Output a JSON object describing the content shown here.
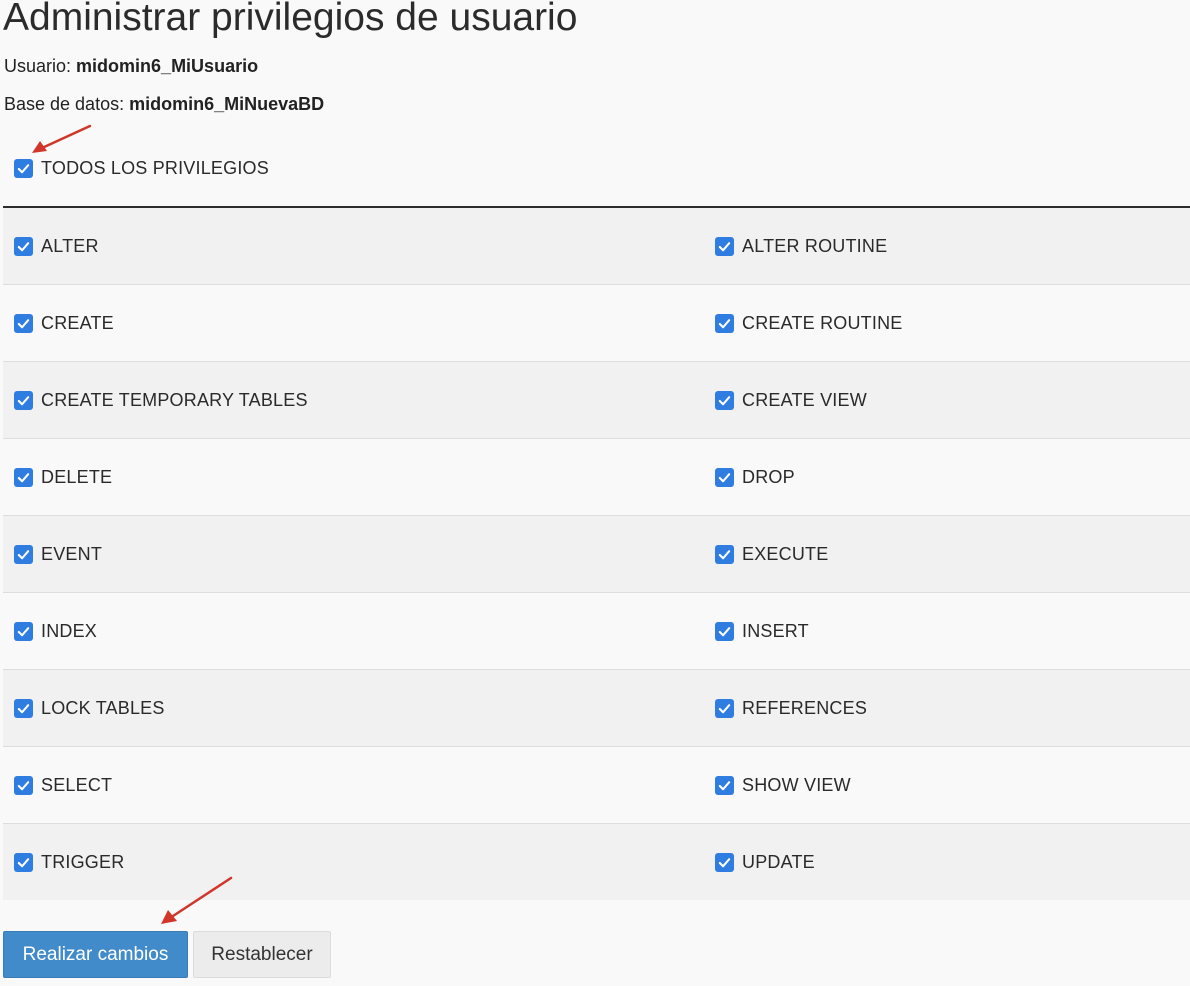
{
  "page": {
    "title": "Administrar privilegios de usuario",
    "user_label": "Usuario:",
    "user_value": "midomin6_MiUsuario",
    "db_label": "Base de datos:",
    "db_value": "midomin6_MiNuevaBD"
  },
  "all_privileges": {
    "label": "TODOS LOS PRIVILEGIOS",
    "checked": true
  },
  "privileges": [
    {
      "left": "ALTER",
      "right": "ALTER ROUTINE"
    },
    {
      "left": "CREATE",
      "right": "CREATE ROUTINE"
    },
    {
      "left": "CREATE TEMPORARY TABLES",
      "right": "CREATE VIEW"
    },
    {
      "left": "DELETE",
      "right": "DROP"
    },
    {
      "left": "EVENT",
      "right": "EXECUTE"
    },
    {
      "left": "INDEX",
      "right": "INSERT"
    },
    {
      "left": "LOCK TABLES",
      "right": "REFERENCES"
    },
    {
      "left": "SELECT",
      "right": "SHOW VIEW"
    },
    {
      "left": "TRIGGER",
      "right": "UPDATE"
    }
  ],
  "buttons": {
    "submit": "Realizar cambios",
    "reset": "Restablecer"
  },
  "colors": {
    "checkbox": "#2f7de1",
    "primary_button": "#428bca",
    "annotation_arrow": "#d0362a"
  },
  "icons": {
    "checkbox_mark": "checkmark-icon",
    "annotation": "red-arrow-icon"
  }
}
